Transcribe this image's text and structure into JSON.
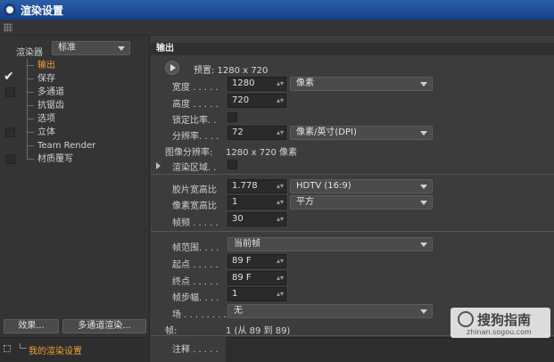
{
  "window": {
    "title": "渲染设置"
  },
  "sidebar": {
    "renderer_label": "渲染器",
    "renderer_value": "标准",
    "items": [
      {
        "label": "输出",
        "active": true,
        "checkbox": "none"
      },
      {
        "label": "保存",
        "active": false,
        "checkbox": "checked"
      },
      {
        "label": "多通道",
        "active": false,
        "checkbox": "unchecked"
      },
      {
        "label": "抗锯齿",
        "active": false,
        "checkbox": "none"
      },
      {
        "label": "选项",
        "active": false,
        "checkbox": "none"
      },
      {
        "label": "立体",
        "active": false,
        "checkbox": "unchecked"
      },
      {
        "label": "Team Render",
        "active": false,
        "checkbox": "none"
      },
      {
        "label": "材质覆写",
        "active": false,
        "checkbox": "unchecked"
      }
    ],
    "effects_button": "效果...",
    "multipass_button": "多通道渲染...",
    "preset_label": "我的渲染设置"
  },
  "output": {
    "section_title": "输出",
    "preset": "预置: 1280 x 720",
    "width_label": "宽度 . . . . .",
    "width_value": "1280",
    "height_label": "高度 . . . . .",
    "height_value": "720",
    "unit_value": "像素",
    "lock_ratio_label": "锁定比率. .",
    "resolution_label": "分辨率. . . .",
    "resolution_value": "72",
    "resolution_unit": "像素/英寸(DPI)",
    "image_resolution_label": "图像分辨率:",
    "image_resolution_value": "1280 x 720 像素",
    "render_region_label": "渲染区域. .",
    "film_aspect_label": "胶片宽高比",
    "film_aspect_value": "1.778",
    "film_aspect_preset": "HDTV (16:9)",
    "pixel_aspect_label": "像素宽高比",
    "pixel_aspect_value": "1",
    "pixel_aspect_preset": "平方",
    "fps_label": "帧频 . . . . .",
    "fps_value": "30",
    "frame_range_label": "帧范围. . . .",
    "frame_range_value": "当前帧",
    "start_label": "起点 . . . . .",
    "start_value": "89 F",
    "end_label": "终点 . . . . .",
    "end_value": "89 F",
    "frame_step_label": "帧步幅. . . .",
    "frame_step_value": "1",
    "field_label": "场 . . . . . . . .",
    "field_value": "无",
    "frames_label": "帧:",
    "frames_value": "1 (从 89 到 89)",
    "notes_label": "注释 . . . . ."
  },
  "watermark": {
    "text": "搜狗指南",
    "url": "zhinan.sogou.com"
  }
}
